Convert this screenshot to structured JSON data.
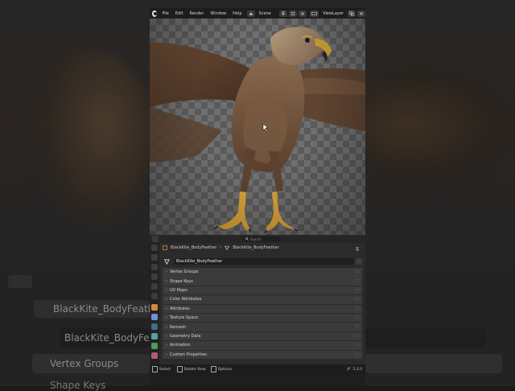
{
  "topbar": {
    "menus": [
      "File",
      "Edit",
      "Render",
      "Window",
      "Help"
    ],
    "scene_label": "Scene",
    "viewlayer_label": "ViewLayer"
  },
  "properties": {
    "search_placeholder": "Search",
    "breadcrumb_object": "BlackKite_BodyFeather",
    "breadcrumb_data": "BlackKite_BodyFeather",
    "mesh_name": "BlackKite_BodyFeather",
    "panels": [
      "Vertex Groups",
      "Shape Keys",
      "UV Maps",
      "Color Attributes",
      "Attributes",
      "Texture Space",
      "Remesh",
      "Geometry Data",
      "Animation",
      "Custom Properties"
    ]
  },
  "statusbar": {
    "select": "Select",
    "rotate": "Rotate View",
    "options": "Options",
    "version": "5.2.0"
  },
  "background": {
    "object_name": "BlackKite_BodyFeather",
    "mesh_name": "BlackKite_BodyFeather",
    "panel_1": "Vertex Groups",
    "panel_2": "Shape Keys"
  },
  "colors": {
    "header": "#1d1d1d",
    "panel": "#3b3b3b",
    "accent": "#4772b3"
  }
}
